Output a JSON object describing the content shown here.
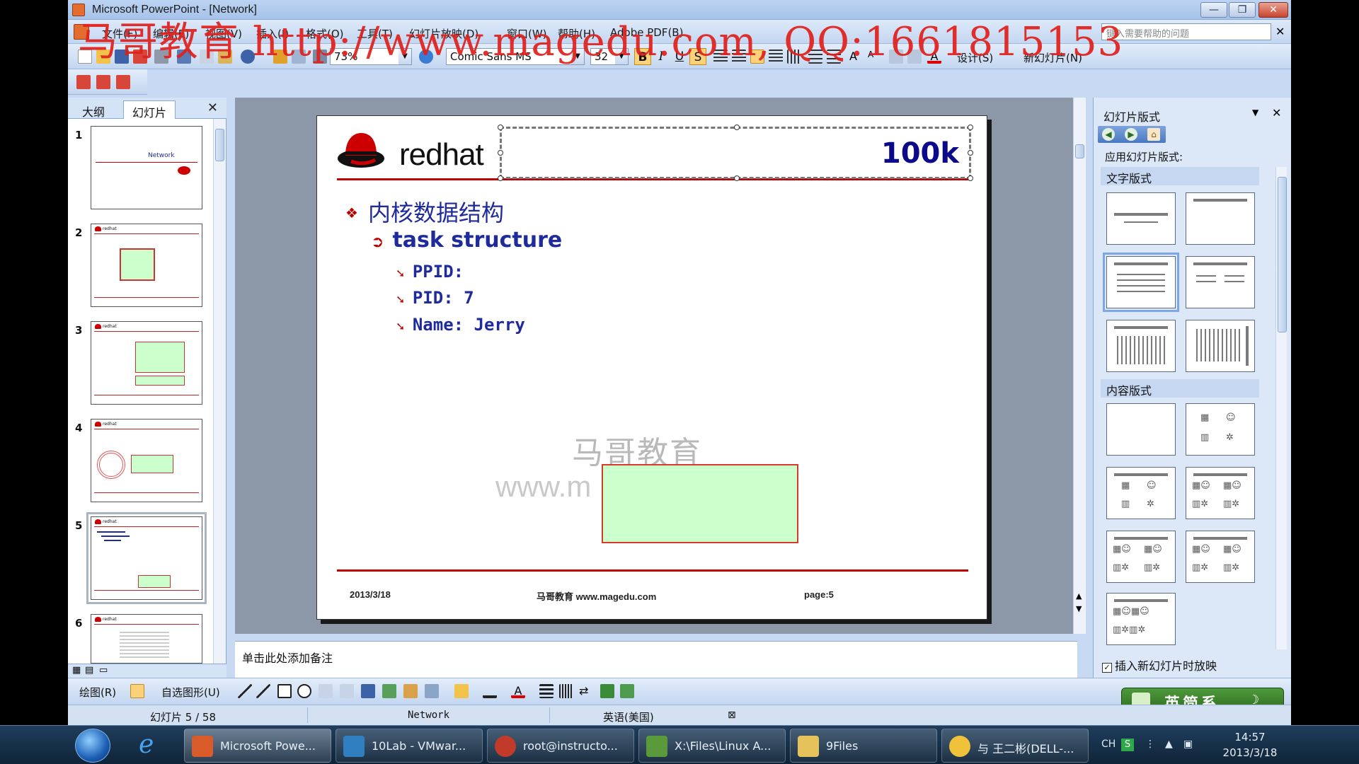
{
  "window": {
    "title": "Microsoft PowerPoint - [Network]",
    "controls": {
      "minimize": "—",
      "maximize": "❐",
      "close": "✕"
    }
  },
  "watermark_overlay": "马哥教育 http://www.magedu.com, QQ:1661815153",
  "menu": {
    "items": [
      "文件(F)",
      "编辑(E)",
      "视图(V)",
      "插入(I)",
      "格式(O)",
      "工具(T)",
      "幻灯片放映(D)",
      "窗口(W)",
      "帮助(H)",
      "Adobe PDF(B)"
    ],
    "help_placeholder": "键入需要帮助的问题",
    "close": "✕"
  },
  "toolbar_standard": {
    "zoom": "73%"
  },
  "toolbar_format": {
    "font": "Comic Sans MS",
    "size": "32",
    "bold": "B",
    "italic": "I",
    "underline": "U",
    "shadow": "S",
    "design": "设计(S)",
    "new_slide": "新幻灯片(N)"
  },
  "left_pane": {
    "tabs": [
      "大纲",
      "幻灯片"
    ],
    "active_tab": 1,
    "close": "✕",
    "slides": [
      {
        "num": "1",
        "label": "Network"
      },
      {
        "num": "2"
      },
      {
        "num": "3"
      },
      {
        "num": "4"
      },
      {
        "num": "5",
        "selected": true
      },
      {
        "num": "6"
      }
    ]
  },
  "slide": {
    "brand": "redhat",
    "title": "100k",
    "bullets": {
      "level1": "内核数据结构",
      "level2": "task structure",
      "level3": [
        "PPID:",
        "PID: 7",
        "Name: Jerry"
      ]
    },
    "watermark_cn": "马哥教育",
    "watermark_url": "www.m",
    "footer": {
      "date": "2013/3/18",
      "center": "马哥教育 www.magedu.com",
      "page": "page:5"
    },
    "colors": {
      "accent_red": "#c00000",
      "text_blue": "#1f2a9c",
      "box_fill": "#ccffcc"
    }
  },
  "notes": {
    "placeholder": "单击此处添加备注"
  },
  "task_pane": {
    "title": "幻灯片版式",
    "apply_label": "应用幻灯片版式:",
    "section_text": "文字版式",
    "section_content": "内容版式",
    "checkbox_label": "插入新幻灯片时放映",
    "checkbox_checked": true
  },
  "drawing_toolbar": {
    "draw": "绘图(R)",
    "autoshapes": "自选图形(U)"
  },
  "status_bar": {
    "slide_info": "幻灯片 5 / 58",
    "design": "Network",
    "language": "英语(美国)"
  },
  "ime_bar": {
    "label": "英简系"
  },
  "taskbar": {
    "apps": [
      {
        "label": "Microsoft Powe..."
      },
      {
        "label": "10Lab - VMwar..."
      },
      {
        "label": "root@instructo..."
      },
      {
        "label": "X:\\Files\\Linux A..."
      },
      {
        "label": "9Files"
      },
      {
        "label": "与 王二彬(DELL-..."
      }
    ],
    "tray_lang": "CH",
    "time": "14:57",
    "date": "2013/3/18"
  }
}
